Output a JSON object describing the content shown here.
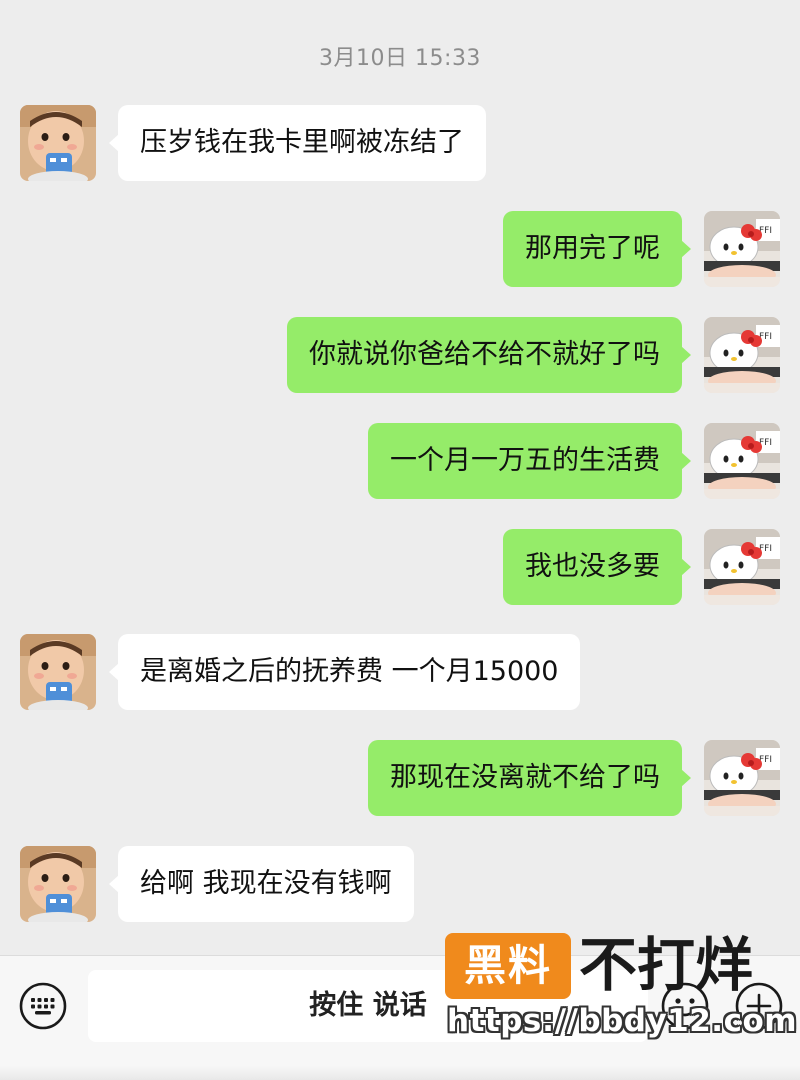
{
  "timestamp": "3月10日 15:33",
  "messages": [
    {
      "side": "left",
      "text": "压岁钱在我卡里啊被冻结了"
    },
    {
      "side": "right",
      "text": "那用完了呢"
    },
    {
      "side": "right",
      "text": "你就说你爸给不给不就好了吗"
    },
    {
      "side": "right",
      "text": "一个月一万五的生活费"
    },
    {
      "side": "right",
      "text": "我也没多要"
    },
    {
      "side": "left",
      "text": "是离婚之后的抚养费 一个月15000"
    },
    {
      "side": "right",
      "text": "那现在没离就不给了吗"
    },
    {
      "side": "left",
      "text": "给啊 我现在没有钱啊"
    }
  ],
  "input_bar": {
    "talk_label": "按住 说话",
    "keyboard_icon": "keyboard-icon",
    "emoji_icon": "emoji-icon",
    "plus_icon": "plus-icon"
  },
  "watermark": {
    "badge": "黑料",
    "text": "不打烊",
    "url": "https://bbdy12.com"
  },
  "colors": {
    "background": "#ededed",
    "sent_bubble": "#95ec69",
    "received_bubble": "#ffffff",
    "watermark_badge": "#f08a1c"
  }
}
